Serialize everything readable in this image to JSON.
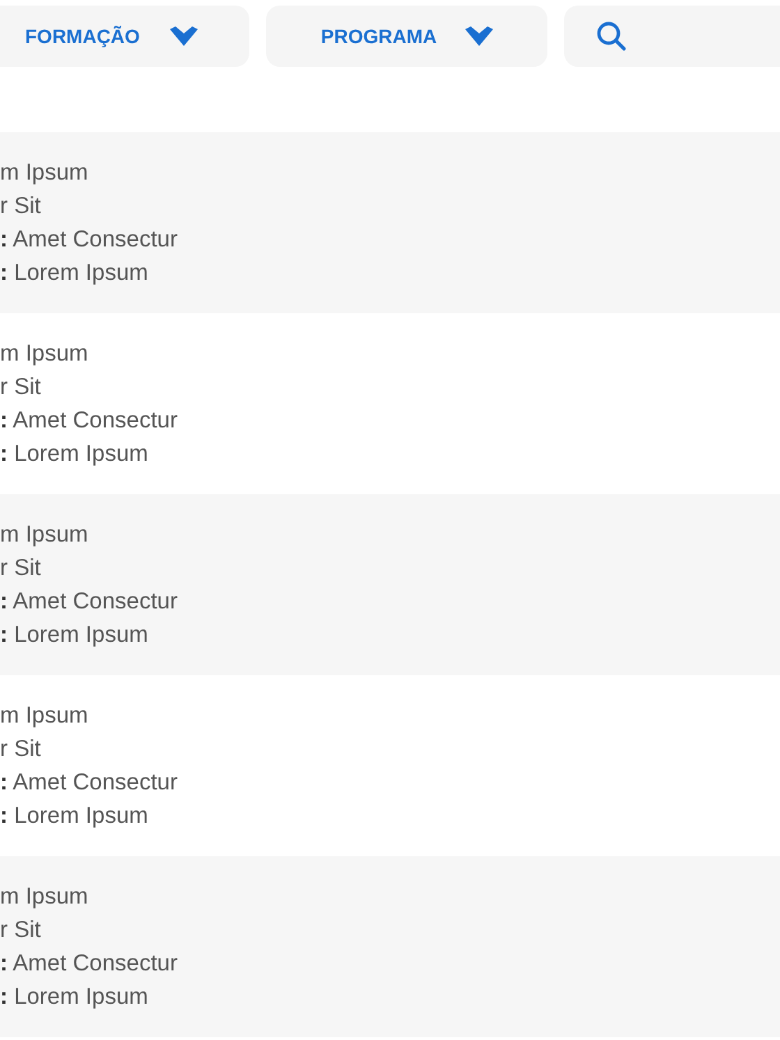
{
  "nav": [
    {
      "kind": "dropdown",
      "label": "FORMAÇÃO"
    },
    {
      "kind": "dropdown",
      "label": "PROGRAMA"
    },
    {
      "kind": "search"
    }
  ],
  "rows": [
    {
      "lines": [
        "m Ipsum",
        "r Sit",
        "**:** Amet Consectur",
        "**:** Lorem Ipsum"
      ]
    },
    {
      "lines": [
        "m Ipsum",
        "r Sit",
        "**:** Amet Consectur",
        "**:** Lorem Ipsum"
      ]
    },
    {
      "lines": [
        "m Ipsum",
        "r Sit",
        "**:** Amet Consectur",
        "**:** Lorem Ipsum"
      ]
    },
    {
      "lines": [
        "m Ipsum",
        "r Sit",
        "**:** Amet Consectur",
        "**:** Lorem Ipsum"
      ]
    },
    {
      "lines": [
        "m Ipsum",
        "r Sit",
        "**:** Amet Consectur",
        "**:** Lorem Ipsum"
      ]
    }
  ]
}
